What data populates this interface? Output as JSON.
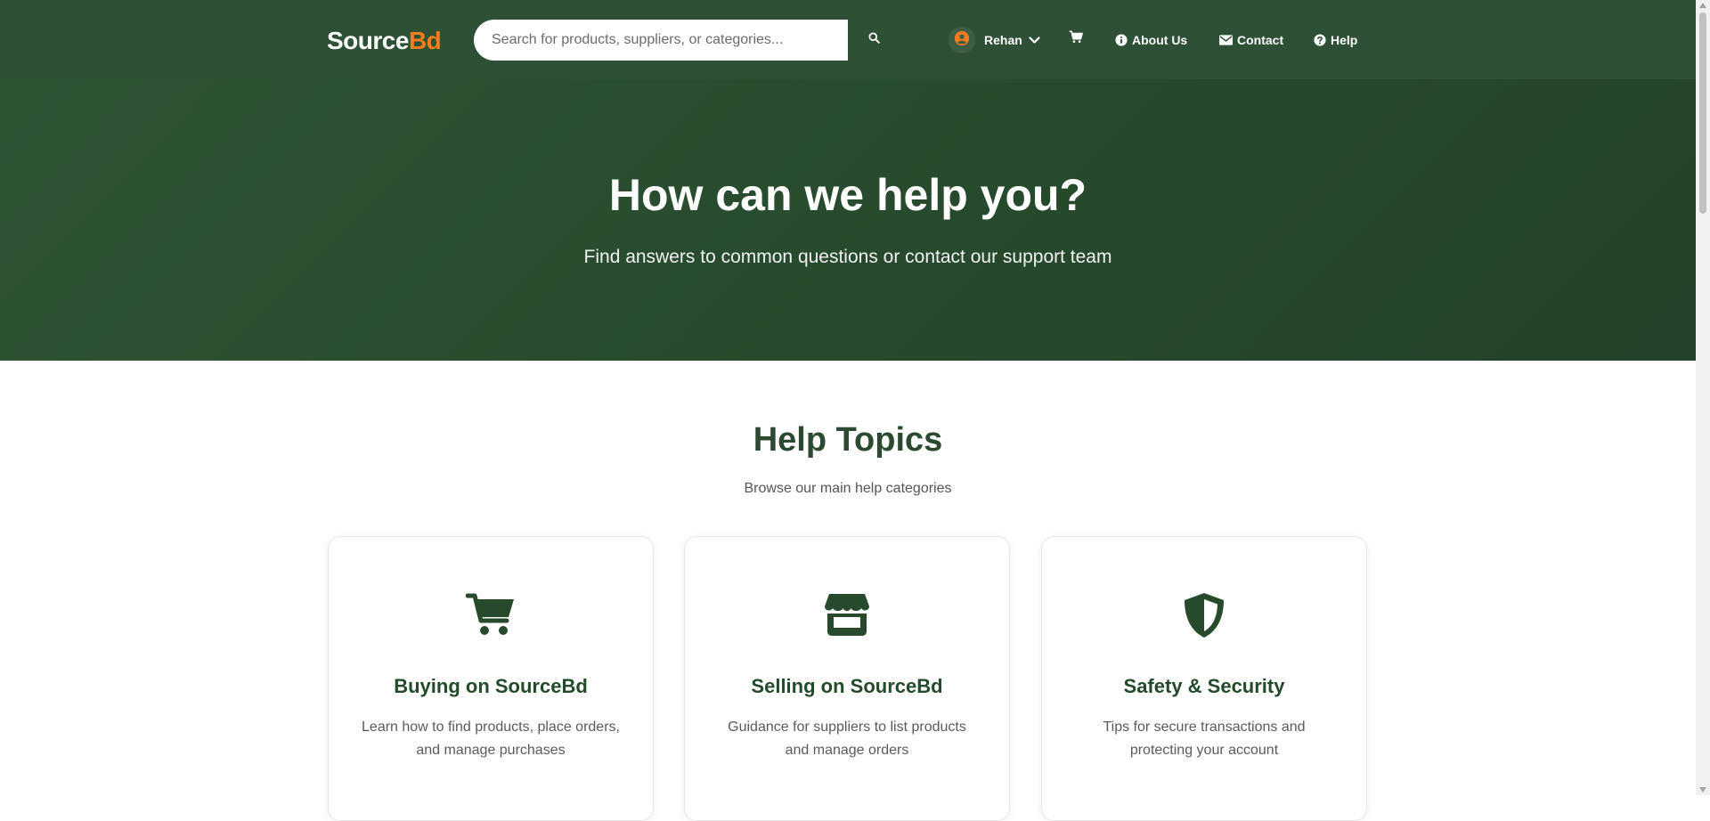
{
  "brand": {
    "name_main": "Source",
    "name_accent": "Bd",
    "accent_color": "#f57c1f",
    "primary_color": "#2e5034"
  },
  "search": {
    "placeholder": "Search for products, suppliers, or categories...",
    "value": "",
    "button_icon": "search-icon"
  },
  "nav": {
    "user_name": "Rehan",
    "user_icon": "user-circle-icon",
    "cart_icon": "cart-icon",
    "links": [
      {
        "label": "About Us",
        "icon": "info-circle-icon"
      },
      {
        "label": "Contact",
        "icon": "envelope-icon"
      },
      {
        "label": "Help",
        "icon": "question-circle-icon"
      }
    ]
  },
  "hero": {
    "title": "How can we help you?",
    "subtitle": "Find answers to common questions or contact our support team"
  },
  "topics": {
    "title": "Help Topics",
    "subtitle": "Browse our main help categories",
    "cards": [
      {
        "icon": "shopping-cart-icon",
        "title": "Buying on SourceBd",
        "description": "Learn how to find products, place orders, and manage purchases"
      },
      {
        "icon": "store-icon",
        "title": "Selling on SourceBd",
        "description": "Guidance for suppliers to list products and manage orders"
      },
      {
        "icon": "shield-icon",
        "title": "Safety & Security",
        "description": "Tips for secure transactions and protecting your account"
      }
    ]
  }
}
